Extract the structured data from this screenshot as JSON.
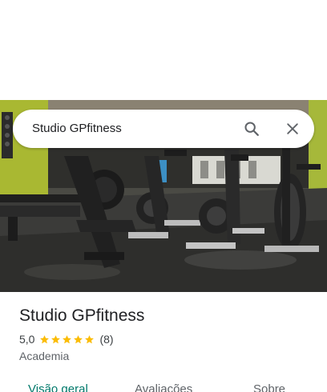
{
  "search": {
    "query": "Studio GPfitness",
    "search_icon": "search-icon",
    "close_icon": "close-icon"
  },
  "hero": {
    "image": "gym-photo-spin-bikes"
  },
  "place": {
    "name": "Studio GPfitness",
    "rating": "5,0",
    "stars": 5,
    "review_count": "(8)",
    "category": "Academia"
  },
  "tabs": [
    {
      "label": "Visão geral",
      "active": true
    },
    {
      "label": "Avaliações",
      "active": false
    },
    {
      "label": "Sobre",
      "active": false
    }
  ],
  "colors": {
    "star": "#fbbc04",
    "active_tab": "#00796b"
  }
}
